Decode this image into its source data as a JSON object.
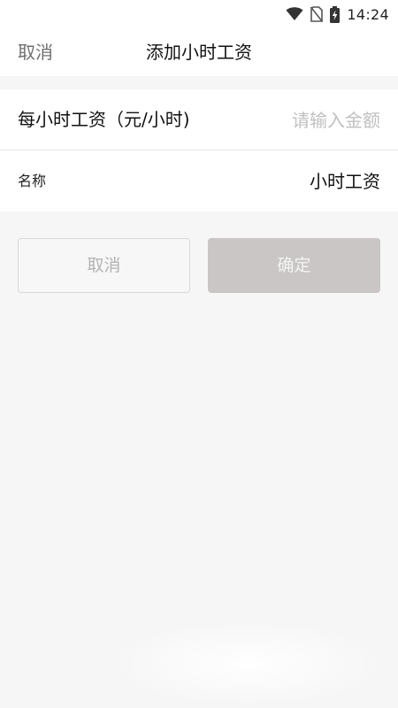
{
  "status_bar": {
    "time": "14:24",
    "icons": [
      "wifi-icon",
      "no-sim-icon",
      "battery-charging-icon"
    ]
  },
  "header": {
    "cancel_label": "取消",
    "title": "添加小时工资"
  },
  "form": {
    "wage_label": "每小时工资（元/小时)",
    "wage_value": "",
    "wage_placeholder": "请输入金额",
    "name_label": "名称",
    "name_value": "小时工资"
  },
  "actions": {
    "cancel_label": "取消",
    "confirm_label": "确定"
  },
  "colors": {
    "background": "#f6f6f6",
    "surface": "#ffffff",
    "confirm_disabled": "#c9c6c5",
    "placeholder": "#c0c0c0"
  }
}
